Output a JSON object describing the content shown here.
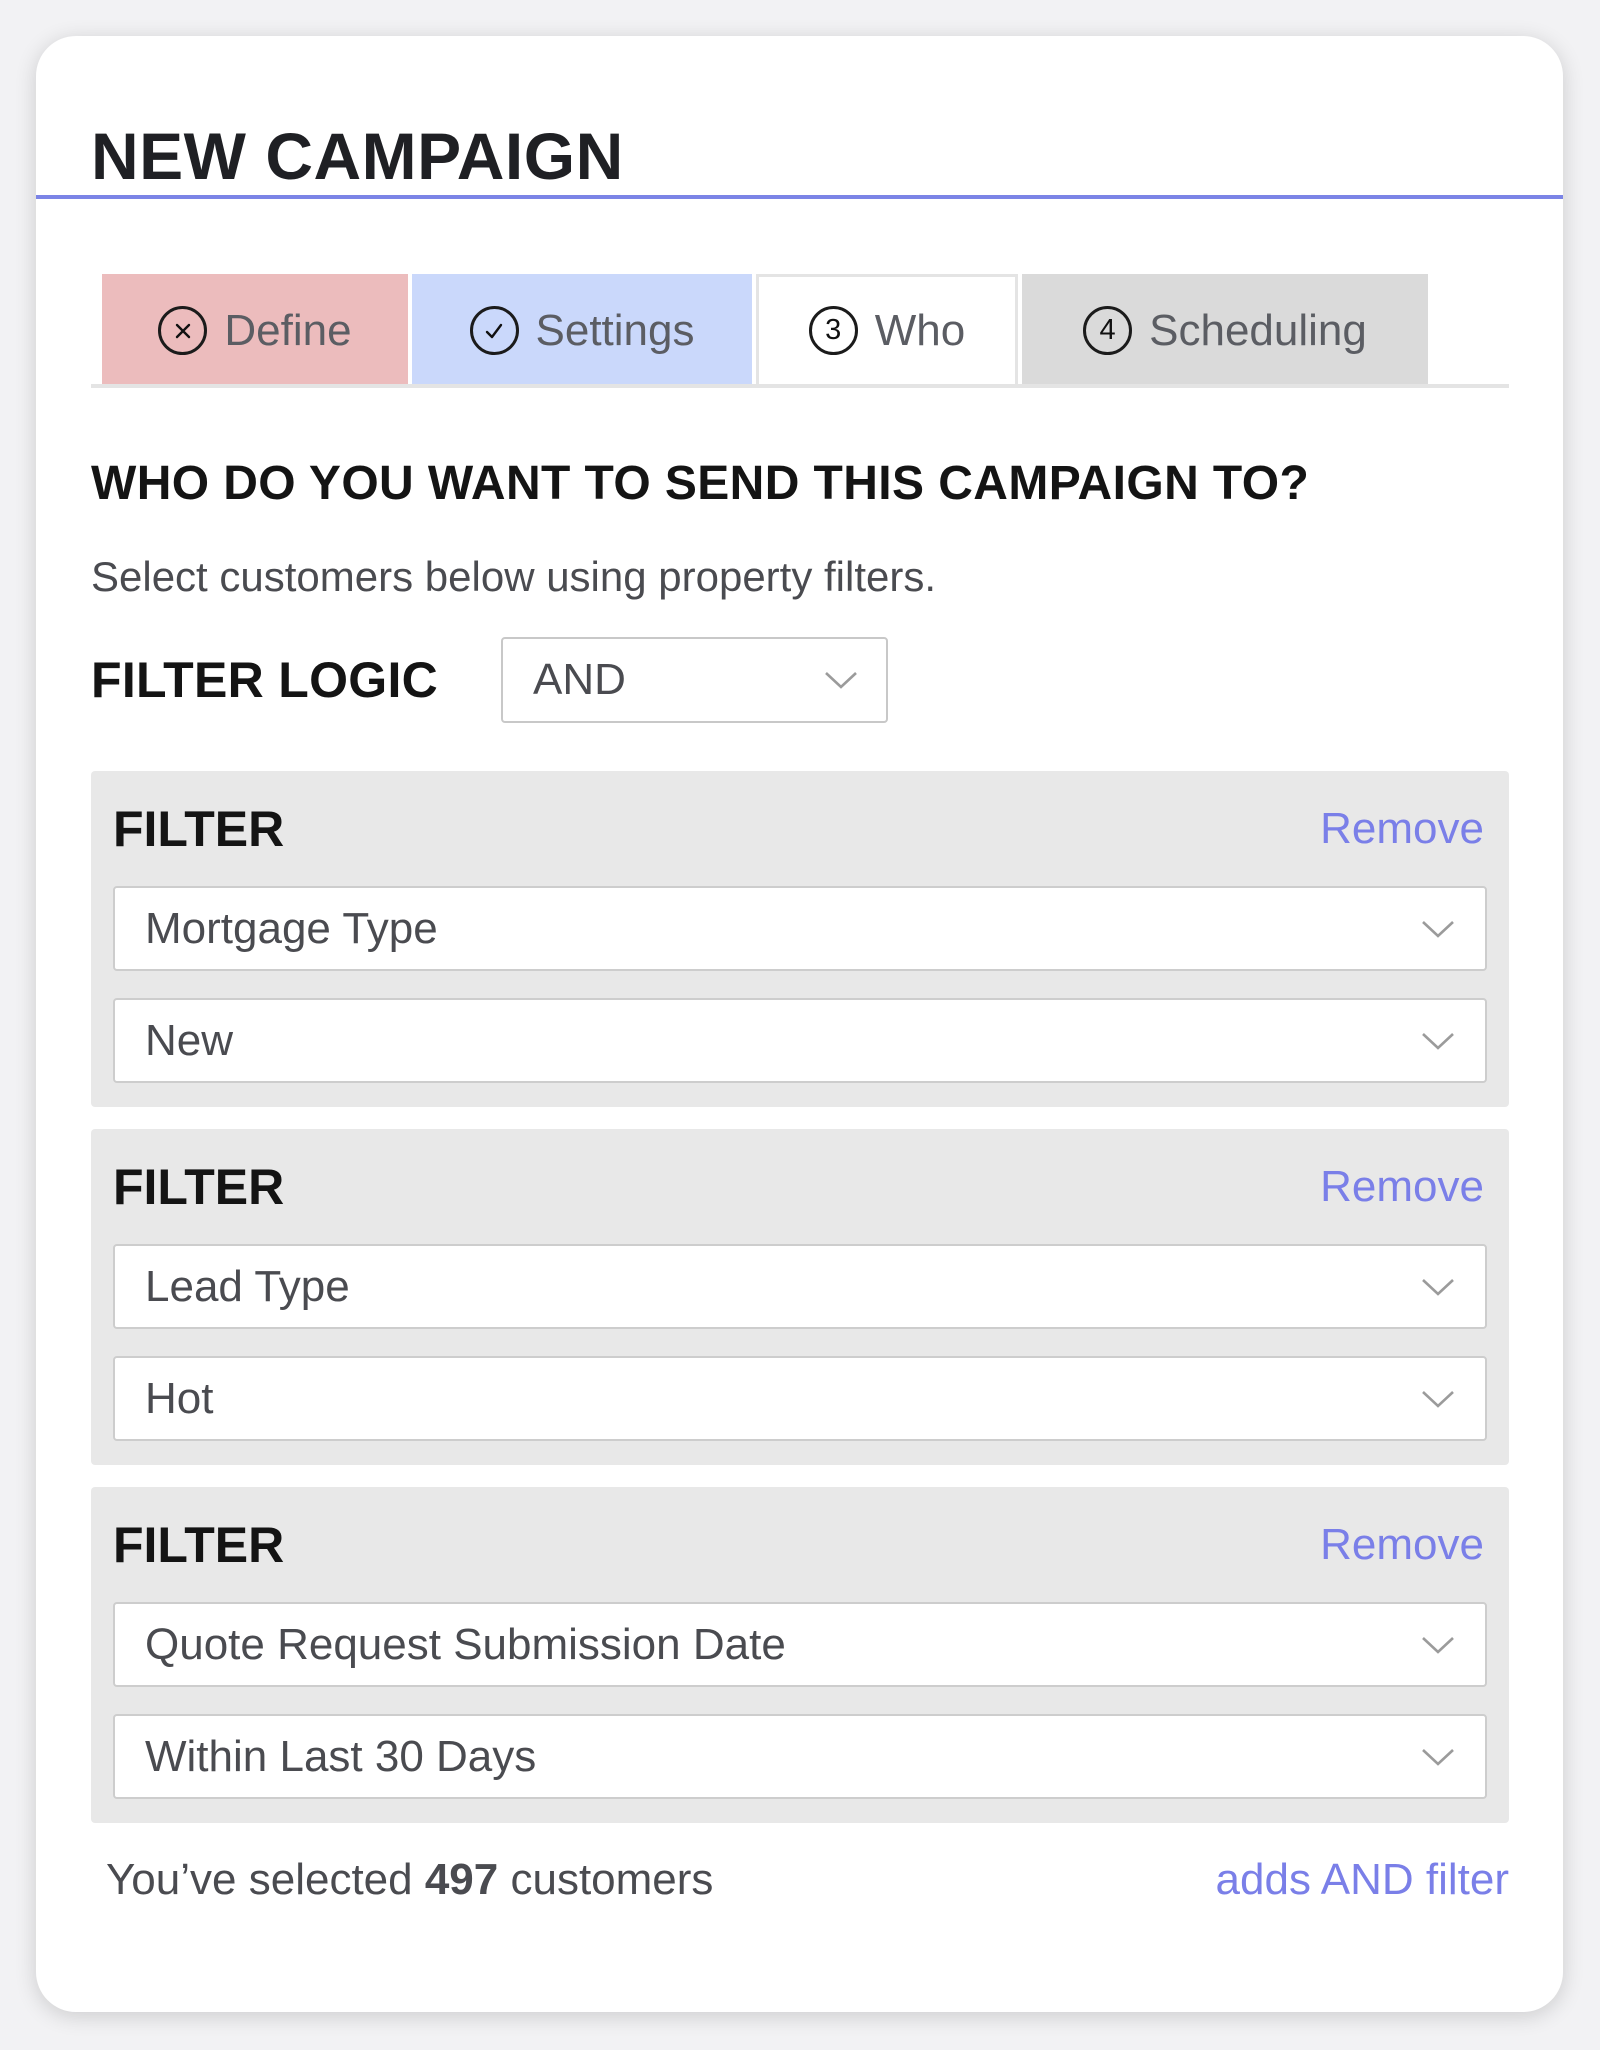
{
  "header": {
    "title": "NEW CAMPAIGN"
  },
  "tabs": [
    {
      "label": "Define",
      "marker": "×",
      "icon": "x-circle-icon",
      "state": "error",
      "color": "#ecbcbd"
    },
    {
      "label": "Settings",
      "marker": "✓",
      "icon": "check-circle-icon",
      "state": "complete",
      "color": "#cad8fb"
    },
    {
      "label": "Who",
      "marker": "3",
      "state": "active",
      "color": "#ffffff"
    },
    {
      "label": "Scheduling",
      "marker": "4",
      "state": "upcoming",
      "color": "#dadada"
    }
  ],
  "section": {
    "heading": "WHO DO YOU WANT TO SEND THIS CAMPAIGN TO?",
    "subtext": "Select customers below using property filters."
  },
  "filter_logic": {
    "label": "FILTER LOGIC",
    "value": "AND"
  },
  "filters": [
    {
      "label": "FILTER",
      "remove_label": "Remove",
      "property": "Mortgage Type",
      "value": "New"
    },
    {
      "label": "FILTER",
      "remove_label": "Remove",
      "property": "Lead Type",
      "value": "Hot"
    },
    {
      "label": "FILTER",
      "remove_label": "Remove",
      "property": "Quote Request Submission Date",
      "value": "Within Last 30 Days"
    }
  ],
  "footer": {
    "selected_prefix": "You’ve selected ",
    "selected_count": "497",
    "selected_suffix": " customers",
    "add_filter_label": "adds AND filter"
  },
  "colors": {
    "accent": "#7a7fe8",
    "divider": "#7b84e6"
  }
}
